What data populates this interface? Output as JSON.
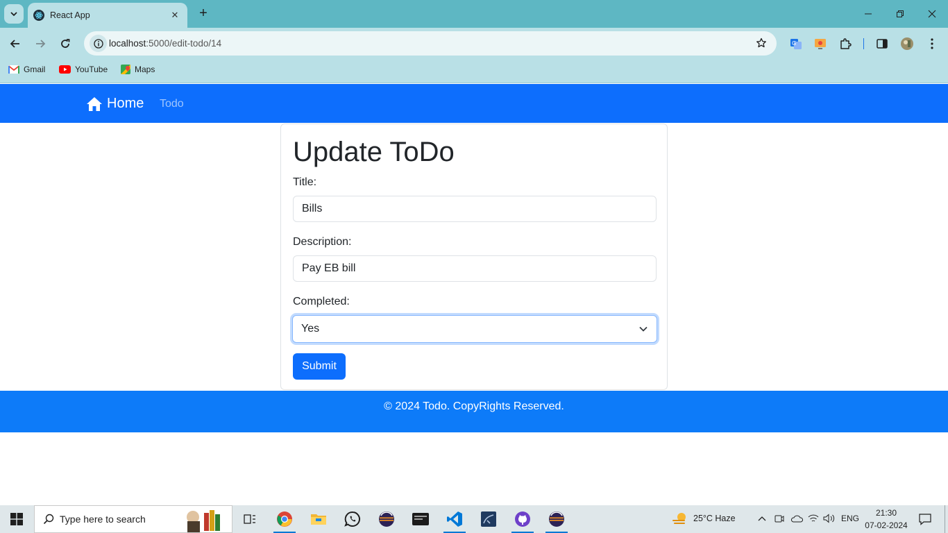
{
  "browser": {
    "tab_title": "React App",
    "url_host": "localhost",
    "url_path": ":5000/edit-todo/14",
    "bookmarks": [
      {
        "label": "Gmail"
      },
      {
        "label": "YouTube"
      },
      {
        "label": "Maps"
      }
    ]
  },
  "navbar": {
    "brand": "Home",
    "link": "Todo"
  },
  "form": {
    "heading": "Update ToDo",
    "title_label": "Title:",
    "title_value": "Bills",
    "description_label": "Description:",
    "description_value": "Pay EB bill",
    "completed_label": "Completed:",
    "completed_value": "Yes",
    "submit_label": "Submit"
  },
  "footer": {
    "text": "© 2024 Todo. CopyRights Reserved."
  },
  "taskbar": {
    "search_placeholder": "Type here to search",
    "weather": "25°C  Haze",
    "language": "ENG",
    "time": "21:30",
    "date": "07-02-2024"
  },
  "colors": {
    "primary": "#0d6efd",
    "footer": "#0d7bf9",
    "chrome_frame": "#5eb7c3",
    "chrome_toolbar": "#b9e0e6"
  }
}
